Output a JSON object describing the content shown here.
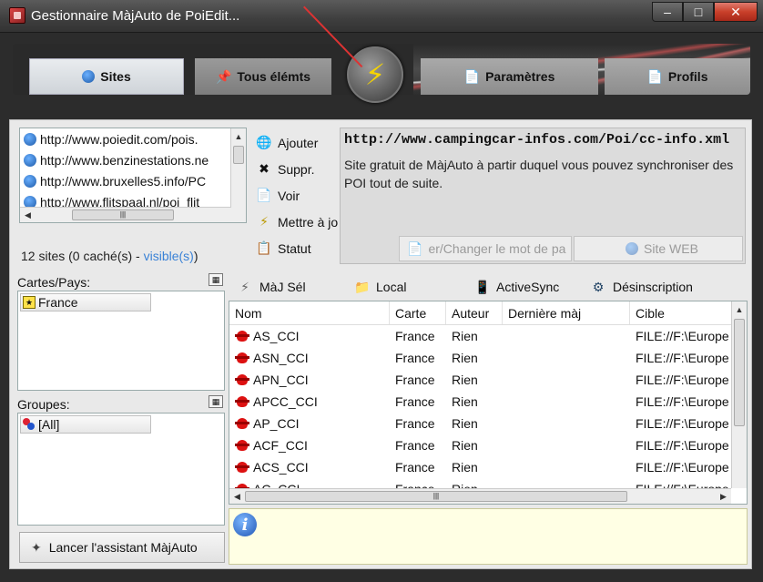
{
  "window": {
    "title": "Gestionnaire MàjAuto de PoiEdit..."
  },
  "window_controls": {
    "minimize": "–",
    "maximize": "□",
    "close": "✕"
  },
  "tabs": [
    {
      "label": "Sites",
      "active": true
    },
    {
      "label": "Tous élémts"
    },
    {
      "label": "Paramètres"
    },
    {
      "label": "Profils"
    }
  ],
  "sites": {
    "items": [
      "http://www.poiedit.com/pois.",
      "http://www.benzinestations.ne",
      "http://www.bruxelles5.info/PC",
      "http://www.flitspaal.nl/poi_flit"
    ],
    "count_text": "12 sites (0 caché(s) - ",
    "visible_link": "visible(s)",
    "count_suffix": ")"
  },
  "site_actions": {
    "add": "Ajouter",
    "delete": "Suppr.",
    "view": "Voir",
    "update": "Mettre à jou",
    "status": "Statut"
  },
  "detail": {
    "url": "http://www.campingcar-infos.com/Poi/cc-info.xml",
    "description": "Site gratuit de MàjAuto à partir duquel vous pouvez synchroniser des POI tout de suite.",
    "password_button": "er/Changer le mot de  pa",
    "web_button": "Site WEB"
  },
  "maps": {
    "label": "Cartes/Pays:",
    "items": [
      "France"
    ]
  },
  "groups": {
    "label": "Groupes:",
    "items": [
      "[All]"
    ]
  },
  "assistant_button": "Lancer l'assistant MàjAuto",
  "toolbar": {
    "update_sel": "MàJ Sél",
    "local": "Local",
    "activesync": "ActiveSync",
    "unsubscribe": "Désinscription"
  },
  "grid": {
    "columns": [
      "Nom",
      "Carte",
      "Auteur",
      "Dernière màj",
      "Cible"
    ],
    "rows": [
      {
        "nom": "AS_CCI",
        "carte": "France",
        "auteur": "Rien",
        "maj": "",
        "cible": "FILE://F:\\Europe"
      },
      {
        "nom": "ASN_CCI",
        "carte": "France",
        "auteur": "Rien",
        "maj": "",
        "cible": "FILE://F:\\Europe"
      },
      {
        "nom": "APN_CCI",
        "carte": "France",
        "auteur": "Rien",
        "maj": "",
        "cible": "FILE://F:\\Europe"
      },
      {
        "nom": "APCC_CCI",
        "carte": "France",
        "auteur": "Rien",
        "maj": "",
        "cible": "FILE://F:\\Europe"
      },
      {
        "nom": "AP_CCI",
        "carte": "France",
        "auteur": "Rien",
        "maj": "",
        "cible": "FILE://F:\\Europe"
      },
      {
        "nom": "ACF_CCI",
        "carte": "France",
        "auteur": "Rien",
        "maj": "",
        "cible": "FILE://F:\\Europe"
      },
      {
        "nom": "ACS_CCI",
        "carte": "France",
        "auteur": "Rien",
        "maj": "",
        "cible": "FILE://F:\\Europe"
      },
      {
        "nom": "AC_CCI",
        "carte": "France",
        "auteur": "Rien",
        "maj": "",
        "cible": "FILE://F:\\Europe"
      }
    ]
  },
  "colors": {
    "accent_link": "#3a82d6",
    "info_bg": "#ffffe4",
    "bolt": "#f5d400"
  }
}
